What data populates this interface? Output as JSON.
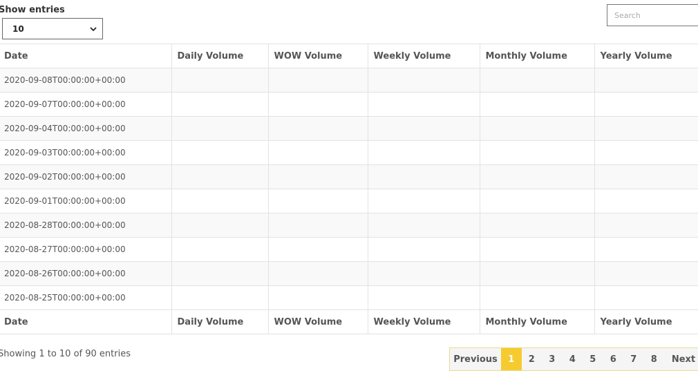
{
  "length": {
    "label": "Show entries",
    "value": "10"
  },
  "search": {
    "placeholder": "Search"
  },
  "icons": {
    "select_arrow": "chevron-down-icon"
  },
  "columns": [
    "Date",
    "Daily Volume",
    "WOW Volume",
    "Weekly Volume",
    "Monthly Volume",
    "Yearly Volume"
  ],
  "rows": [
    {
      "date": "2020-09-08T00:00:00+00:00",
      "daily": "",
      "wow": "",
      "weekly": "",
      "monthly": "",
      "yearly": ""
    },
    {
      "date": "2020-09-07T00:00:00+00:00",
      "daily": "",
      "wow": "",
      "weekly": "",
      "monthly": "",
      "yearly": ""
    },
    {
      "date": "2020-09-04T00:00:00+00:00",
      "daily": "",
      "wow": "",
      "weekly": "",
      "monthly": "",
      "yearly": ""
    },
    {
      "date": "2020-09-03T00:00:00+00:00",
      "daily": "",
      "wow": "",
      "weekly": "",
      "monthly": "",
      "yearly": ""
    },
    {
      "date": "2020-09-02T00:00:00+00:00",
      "daily": "",
      "wow": "",
      "weekly": "",
      "monthly": "",
      "yearly": ""
    },
    {
      "date": "2020-09-01T00:00:00+00:00",
      "daily": "",
      "wow": "",
      "weekly": "",
      "monthly": "",
      "yearly": ""
    },
    {
      "date": "2020-08-28T00:00:00+00:00",
      "daily": "",
      "wow": "",
      "weekly": "",
      "monthly": "",
      "yearly": ""
    },
    {
      "date": "2020-08-27T00:00:00+00:00",
      "daily": "",
      "wow": "",
      "weekly": "",
      "monthly": "",
      "yearly": ""
    },
    {
      "date": "2020-08-26T00:00:00+00:00",
      "daily": "",
      "wow": "",
      "weekly": "",
      "monthly": "",
      "yearly": ""
    },
    {
      "date": "2020-08-25T00:00:00+00:00",
      "daily": "",
      "wow": "",
      "weekly": "",
      "monthly": "",
      "yearly": ""
    }
  ],
  "info": "Showing 1 to 10 of 90 entries",
  "pagination": {
    "previous": "Previous",
    "next": "Next",
    "pages": [
      "1",
      "2",
      "3",
      "4",
      "5",
      "6",
      "7",
      "8"
    ],
    "current": "1"
  },
  "colors": {
    "accent": "#f6cb2f",
    "pager_border": "#e8dc8c",
    "pager_bg": "#f5f5f5"
  }
}
